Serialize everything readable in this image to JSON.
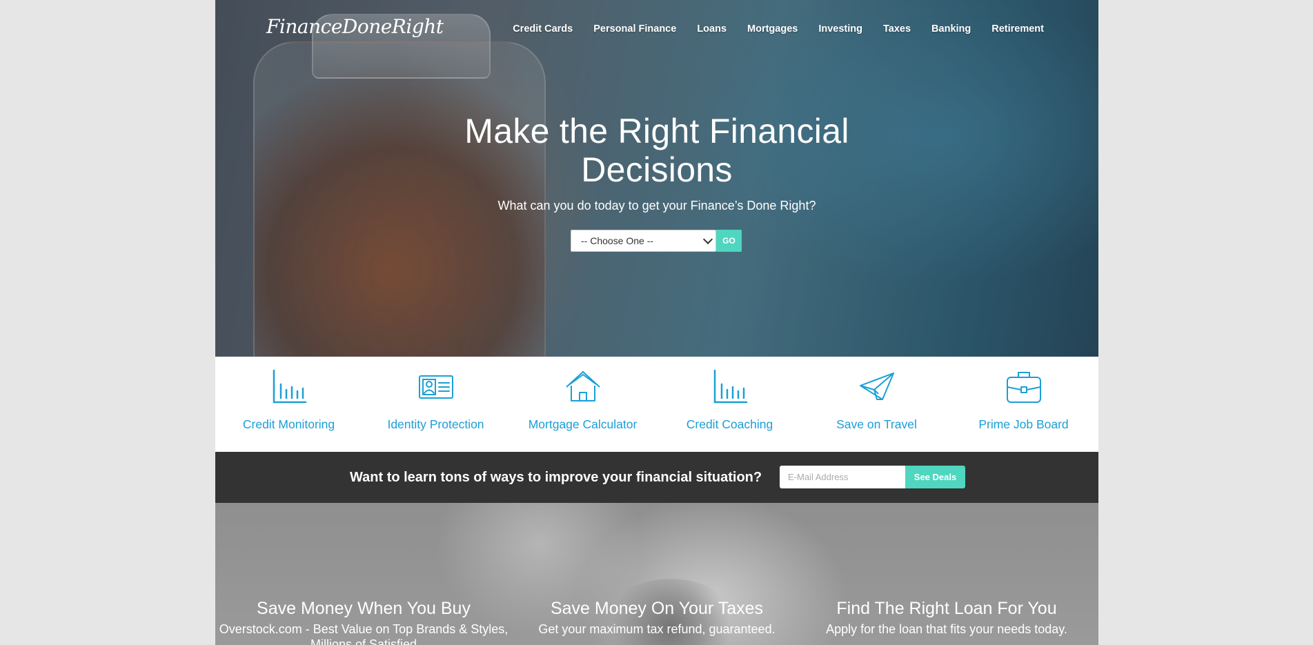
{
  "brand": {
    "logo_text": "FinanceDoneRight"
  },
  "nav": {
    "items": [
      {
        "label": "Credit Cards"
      },
      {
        "label": "Personal Finance"
      },
      {
        "label": "Loans"
      },
      {
        "label": "Mortgages"
      },
      {
        "label": "Investing"
      },
      {
        "label": "Taxes"
      },
      {
        "label": "Banking"
      },
      {
        "label": "Retirement"
      }
    ]
  },
  "hero": {
    "title": "Make the Right Financial Decisions",
    "subtitle": "What can you do today to get your Finance’s Done Right?",
    "select_value": "-- Choose One --",
    "go_label": "GO"
  },
  "features": [
    {
      "label": "Credit Monitoring",
      "icon": "bar-chart-icon"
    },
    {
      "label": "Identity Protection",
      "icon": "id-card-icon"
    },
    {
      "label": "Mortgage Calculator",
      "icon": "house-icon"
    },
    {
      "label": "Credit Coaching",
      "icon": "bar-chart-icon"
    },
    {
      "label": "Save on Travel",
      "icon": "paper-plane-icon"
    },
    {
      "label": "Prime Job Board",
      "icon": "briefcase-icon"
    }
  ],
  "newsletter": {
    "text": "Want to learn tons of ways to improve your financial situation?",
    "email_placeholder": "E-Mail Address",
    "button_label": "See Deals"
  },
  "promos": [
    {
      "title": "Save Money When You Buy",
      "text": "Overstock.com - Best Value on Top Brands & Styles, Millions of Satisfied"
    },
    {
      "title": "Save Money On Your Taxes",
      "text": "Get your maximum tax refund, guaranteed."
    },
    {
      "title": "Find The Right Loan For You",
      "text": "Apply for the loan that fits your needs today."
    }
  ],
  "colors": {
    "accent": "#4fd6c0",
    "icon_blue": "#1a9fd6",
    "dark_band": "#333333"
  }
}
